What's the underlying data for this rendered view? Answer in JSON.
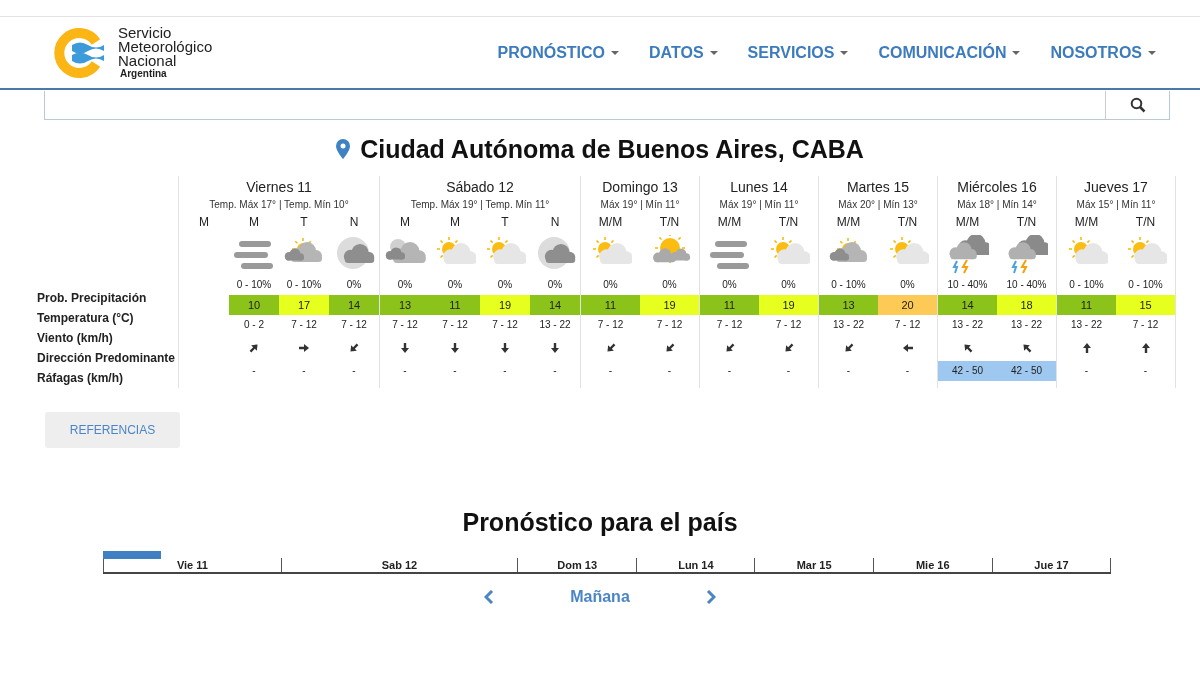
{
  "logo": {
    "name_lines": [
      "Servicio",
      "Meteorológico",
      "Nacional"
    ],
    "country": "Argentina"
  },
  "nav": [
    {
      "label": "PRONÓSTICO"
    },
    {
      "label": "DATOS"
    },
    {
      "label": "SERVICIOS"
    },
    {
      "label": "COMUNICACIÓN"
    },
    {
      "label": "NOSOTROS"
    }
  ],
  "location": "Ciudad Autónoma de Buenos Aires, CABA",
  "row_labels": [
    "Prob. Precipitación",
    "Temperatura (°C)",
    "Viento (km/h)",
    "Dirección Predominante",
    "Ráfagas (km/h)"
  ],
  "days": [
    {
      "name": "Viernes 11",
      "summary": "Temp. Máx 17° | Temp. Mín 10°",
      "periods": [
        {
          "label": "M"
        },
        {
          "label": "M",
          "sky": {
            "kind": "fog"
          },
          "precip": "0 - 10%",
          "temp": "10",
          "color": "#8cc31a",
          "wind": "0 - 2",
          "arrow": {
            "kind": "ne"
          },
          "gusts": "-",
          "gust_alert": false
        },
        {
          "label": "T",
          "sky": {
            "kind": "suncloudgrey"
          },
          "precip": "0 - 10%",
          "temp": "17",
          "color": "#e6ff1e",
          "wind": "7 - 12",
          "arrow": {
            "kind": "e"
          },
          "gusts": "-",
          "gust_alert": false
        },
        {
          "label": "N",
          "sky": {
            "kind": "mooncloud"
          },
          "precip": "0%",
          "temp": "14",
          "color": "#8cc31a",
          "wind": "7 - 12",
          "arrow": {
            "kind": "sw"
          },
          "gusts": "-",
          "gust_alert": false
        }
      ]
    },
    {
      "name": "Sábado 12",
      "summary": "Temp. Máx 19° | Temp. Mín 11°",
      "periods": [
        {
          "label": "M",
          "sky": {
            "kind": "mooncloudgrey"
          },
          "precip": "0%",
          "temp": "13",
          "color": "#8cc31a",
          "wind": "7 - 12",
          "arrow": {
            "kind": "s"
          },
          "gusts": "-",
          "gust_alert": false
        },
        {
          "label": "M",
          "sky": {
            "kind": "suncloud"
          },
          "precip": "0%",
          "temp": "11",
          "color": "#8cc31a",
          "wind": "7 - 12",
          "arrow": {
            "kind": "s"
          },
          "gusts": "-",
          "gust_alert": false
        },
        {
          "label": "T",
          "sky": {
            "kind": "suncloud"
          },
          "precip": "0%",
          "temp": "19",
          "color": "#e6ff1e",
          "wind": "7 - 12",
          "arrow": {
            "kind": "s"
          },
          "gusts": "-",
          "gust_alert": false
        },
        {
          "label": "N",
          "sky": {
            "kind": "mooncloud"
          },
          "precip": "0%",
          "temp": "14",
          "color": "#8cc31a",
          "wind": "13 - 22",
          "arrow": {
            "kind": "s"
          },
          "gusts": "-",
          "gust_alert": false
        }
      ]
    },
    {
      "name": "Domingo 13",
      "summary": "Máx 19° | Mín 11°",
      "periods": [
        {
          "label": "M/M",
          "sky": {
            "kind": "suncloud"
          },
          "precip": "0%",
          "temp": "11",
          "color": "#8cc31a",
          "wind": "7 - 12",
          "arrow": {
            "kind": "sw"
          },
          "gusts": "-",
          "gust_alert": false
        },
        {
          "label": "T/N",
          "sky": {
            "kind": "sunbig"
          },
          "precip": "0%",
          "temp": "19",
          "color": "#e6ff1e",
          "wind": "7 - 12",
          "arrow": {
            "kind": "sw"
          },
          "gusts": "-",
          "gust_alert": false
        }
      ]
    },
    {
      "name": "Lunes 14",
      "summary": "Máx 19° | Mín 11°",
      "periods": [
        {
          "label": "M/M",
          "sky": {
            "kind": "fog"
          },
          "precip": "0%",
          "temp": "11",
          "color": "#8cc31a",
          "wind": "7 - 12",
          "arrow": {
            "kind": "sw"
          },
          "gusts": "-",
          "gust_alert": false
        },
        {
          "label": "T/N",
          "sky": {
            "kind": "suncloud"
          },
          "precip": "0%",
          "temp": "19",
          "color": "#e6ff1e",
          "wind": "7 - 12",
          "arrow": {
            "kind": "sw"
          },
          "gusts": "-",
          "gust_alert": false
        }
      ]
    },
    {
      "name": "Martes 15",
      "summary": "Máx 20° | Mín 13°",
      "periods": [
        {
          "label": "M/M",
          "sky": {
            "kind": "suncloudgrey"
          },
          "precip": "0 - 10%",
          "temp": "13",
          "color": "#8cc31a",
          "wind": "13 - 22",
          "arrow": {
            "kind": "sw"
          },
          "gusts": "-",
          "gust_alert": false
        },
        {
          "label": "T/N",
          "sky": {
            "kind": "suncloud"
          },
          "precip": "0%",
          "temp": "20",
          "color": "#fdca55",
          "wind": "7 - 12",
          "arrow": {
            "kind": "w"
          },
          "gusts": "-",
          "gust_alert": false
        }
      ]
    },
    {
      "name": "Miércoles 16",
      "summary": "Máx 18° | Mín 14°",
      "periods": [
        {
          "label": "M/M",
          "sky": {
            "kind": "storm"
          },
          "precip": "10 - 40%",
          "temp": "14",
          "color": "#8cc31a",
          "wind": "13 - 22",
          "arrow": {
            "kind": "nw"
          },
          "gusts": "42 - 50",
          "gust_alert": true
        },
        {
          "label": "T/N",
          "sky": {
            "kind": "storm"
          },
          "precip": "10 - 40%",
          "temp": "18",
          "color": "#e6ff1e",
          "wind": "13 - 22",
          "arrow": {
            "kind": "nw"
          },
          "gusts": "42 - 50",
          "gust_alert": true
        }
      ]
    },
    {
      "name": "Jueves 17",
      "summary": "Máx 15° | Mín 11°",
      "periods": [
        {
          "label": "M/M",
          "sky": {
            "kind": "suncloud"
          },
          "precip": "0 - 10%",
          "temp": "11",
          "color": "#8cc31a",
          "wind": "13 - 22",
          "arrow": {
            "kind": "n"
          },
          "gusts": "-",
          "gust_alert": false
        },
        {
          "label": "T/N",
          "sky": {
            "kind": "suncloud"
          },
          "precip": "0 - 10%",
          "temp": "15",
          "color": "#e6ff1e",
          "wind": "7 - 12",
          "arrow": {
            "kind": "n"
          },
          "gusts": "-",
          "gust_alert": false
        }
      ]
    }
  ],
  "references_button": "REFERENCIAS",
  "country_title": "Pronóstico para el país",
  "timeline": {
    "level": 0.058,
    "days": [
      "Vie 11",
      "Sab 12",
      "Dom 13",
      "Lun 14",
      "Mar 15",
      "Mie 16",
      "Jue 17"
    ]
  },
  "period_nav": {
    "label": "Mañana"
  }
}
